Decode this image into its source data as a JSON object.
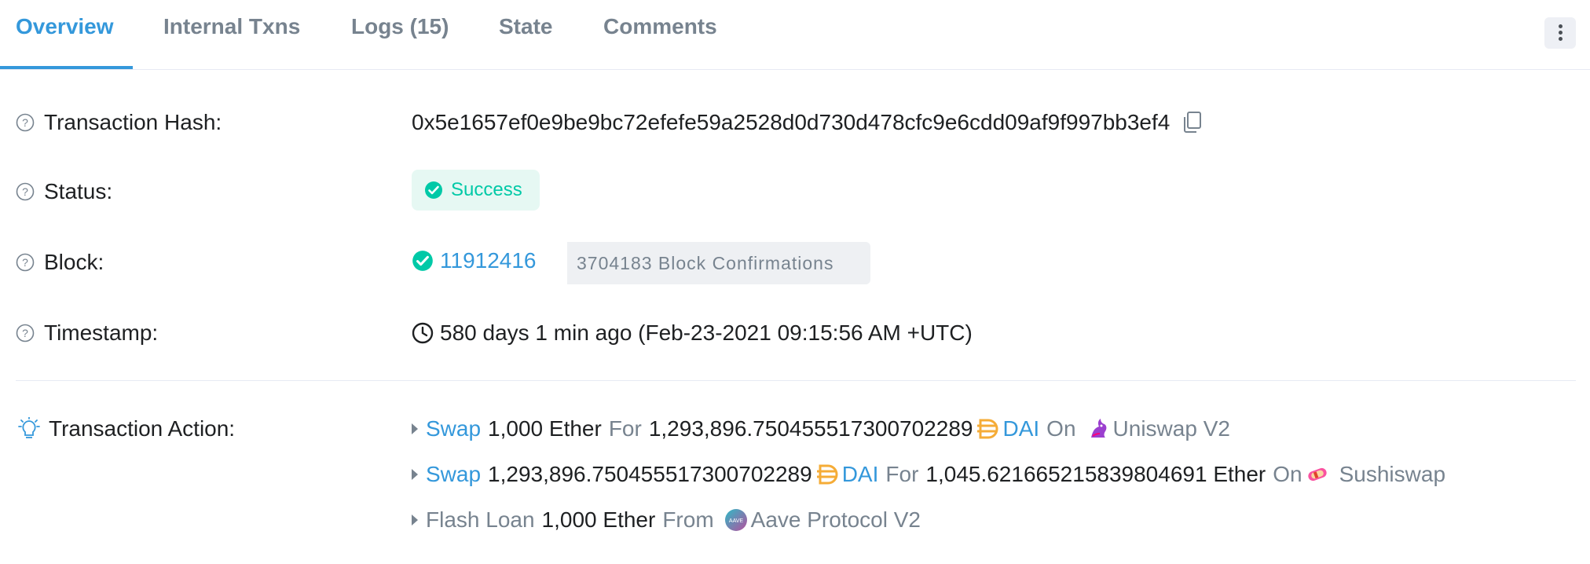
{
  "tabs": [
    {
      "label": "Overview",
      "active": true
    },
    {
      "label": "Internal Txns"
    },
    {
      "label": "Logs (15)"
    },
    {
      "label": "State"
    },
    {
      "label": "Comments"
    }
  ],
  "tx": {
    "hash_label": "Transaction Hash:",
    "hash": "0x5e1657ef0e9be9bc72efefe59a2528d0d730d478cfc9e6cdd09af9f997bb3ef4",
    "status_label": "Status:",
    "status": "Success",
    "block_label": "Block:",
    "block": "11912416",
    "confirmations": "3704183 Block Confirmations",
    "timestamp_label": "Timestamp:",
    "timestamp": "580 days 1 min ago (Feb-23-2021 09:15:56 AM +UTC)",
    "action_label": "Transaction Action:"
  },
  "actions": [
    {
      "verb": "Swap",
      "amount1": "1,000 Ether",
      "for": "For",
      "amount2": "1,293,896.750455517300702289",
      "token": "DAI",
      "on": "On",
      "protocol": "Uniswap V2"
    },
    {
      "verb": "Swap",
      "amount1": "1,293,896.750455517300702289",
      "token": "DAI",
      "for": "For",
      "amount2": "1,045.621665215839804691 Ether",
      "on": "On",
      "protocol": "Sushiswap"
    },
    {
      "verb": "Flash Loan",
      "amount1": "1,000 Ether",
      "from": "From",
      "protocol": "Aave Protocol V2"
    }
  ],
  "colors": {
    "accent": "#3498db",
    "success": "#00c9a7",
    "muted": "#77838f",
    "dai": "#f5ac37"
  },
  "icons": [
    "question-icon",
    "copy-icon",
    "check-circle-icon",
    "clock-icon",
    "lightbulb-icon",
    "caret-right-icon",
    "dai-icon",
    "uniswap-icon",
    "sushiswap-icon",
    "aave-icon",
    "more-vertical-icon"
  ]
}
